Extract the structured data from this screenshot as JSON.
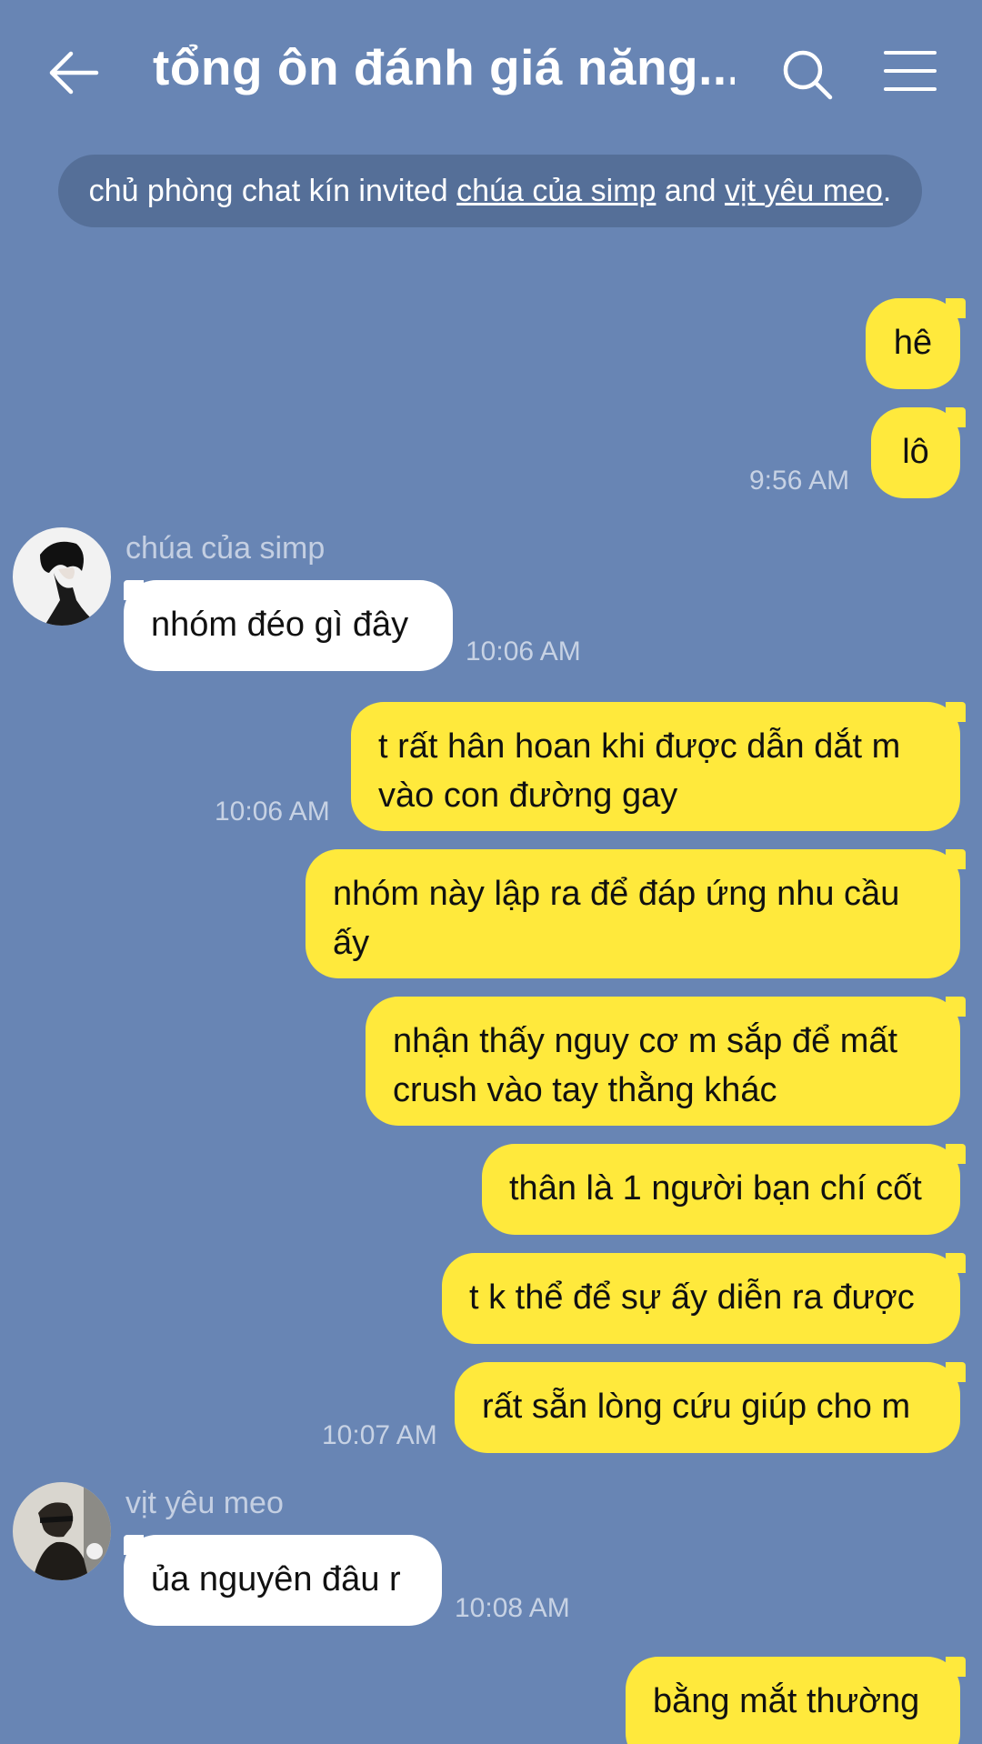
{
  "header": {
    "title": "tổng ôn đánh giá năng...",
    "back_icon": "arrow-left-icon",
    "search_icon": "search-icon",
    "menu_icon": "hamburger-menu-icon"
  },
  "notice": {
    "inviter": "chủ phòng chat kín",
    "invited_text": " invited ",
    "invitee1": "chúa của simp",
    "and_text": " and ",
    "invitee2": "vịt yêu meo",
    "end": "."
  },
  "messages": {
    "m1": "hê",
    "m2": "lô",
    "t1": "9:56 AM",
    "sender1": "chúa của simp",
    "m3": "nhóm đéo gì đây",
    "t2": "10:06 AM",
    "m4_l1": "t rất hân hoan khi được dẫn dắt m",
    "m4_l2": "vào con đường gay",
    "t3": "10:06 AM",
    "m5_l1": "nhóm này lập ra để đáp ứng nhu cầu",
    "m5_l2": "ấy",
    "m6_l1": "nhận thấy nguy cơ m sắp để mất",
    "m6_l2": "crush vào tay thằng khác",
    "m7": "thân là 1 người bạn chí cốt",
    "m8": "t k thể để sự ấy diễn ra được",
    "m9": "rất sẵn lòng cứu giúp cho m",
    "t4": "10:07 AM",
    "sender2": "vịt yêu meo",
    "m10": "ủa nguyên đâu r",
    "t5": "10:08 AM",
    "m11": "bằng mắt thường"
  },
  "colors": {
    "background": "#6885b4",
    "outgoing_bubble": "#ffe93c",
    "incoming_bubble": "#ffffff",
    "timestamp": "#c7d2e4"
  }
}
